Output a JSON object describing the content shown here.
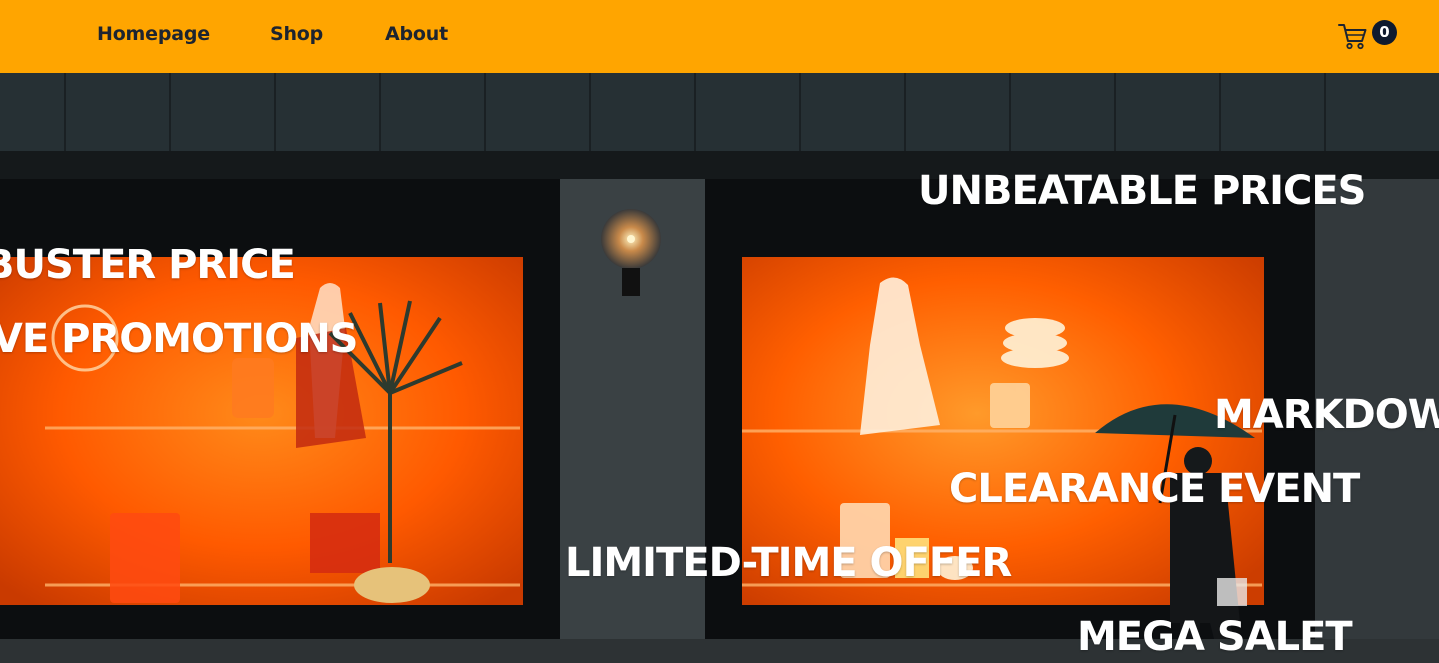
{
  "nav": {
    "links": [
      {
        "label": "Homepage"
      },
      {
        "label": "Shop"
      },
      {
        "label": "About"
      }
    ]
  },
  "cart": {
    "icon": "shopping-cart-icon",
    "count": "0"
  },
  "hero": {
    "image": "storefront-night-photo",
    "promotions": [
      "UNBEATABLE PRICES",
      "BUSTER PRICE",
      "IVE PROMOTIONS",
      "MARKDOW",
      "CLEARANCE EVENT",
      "LIMITED-TIME OFFER",
      "MEGA SALET"
    ]
  },
  "colors": {
    "header_bg": "#ffa500",
    "nav_text": "#1d2430",
    "badge_bg": "#0f1a2e",
    "promo_text": "#ffffff",
    "window_glow": "#ff5a00"
  }
}
